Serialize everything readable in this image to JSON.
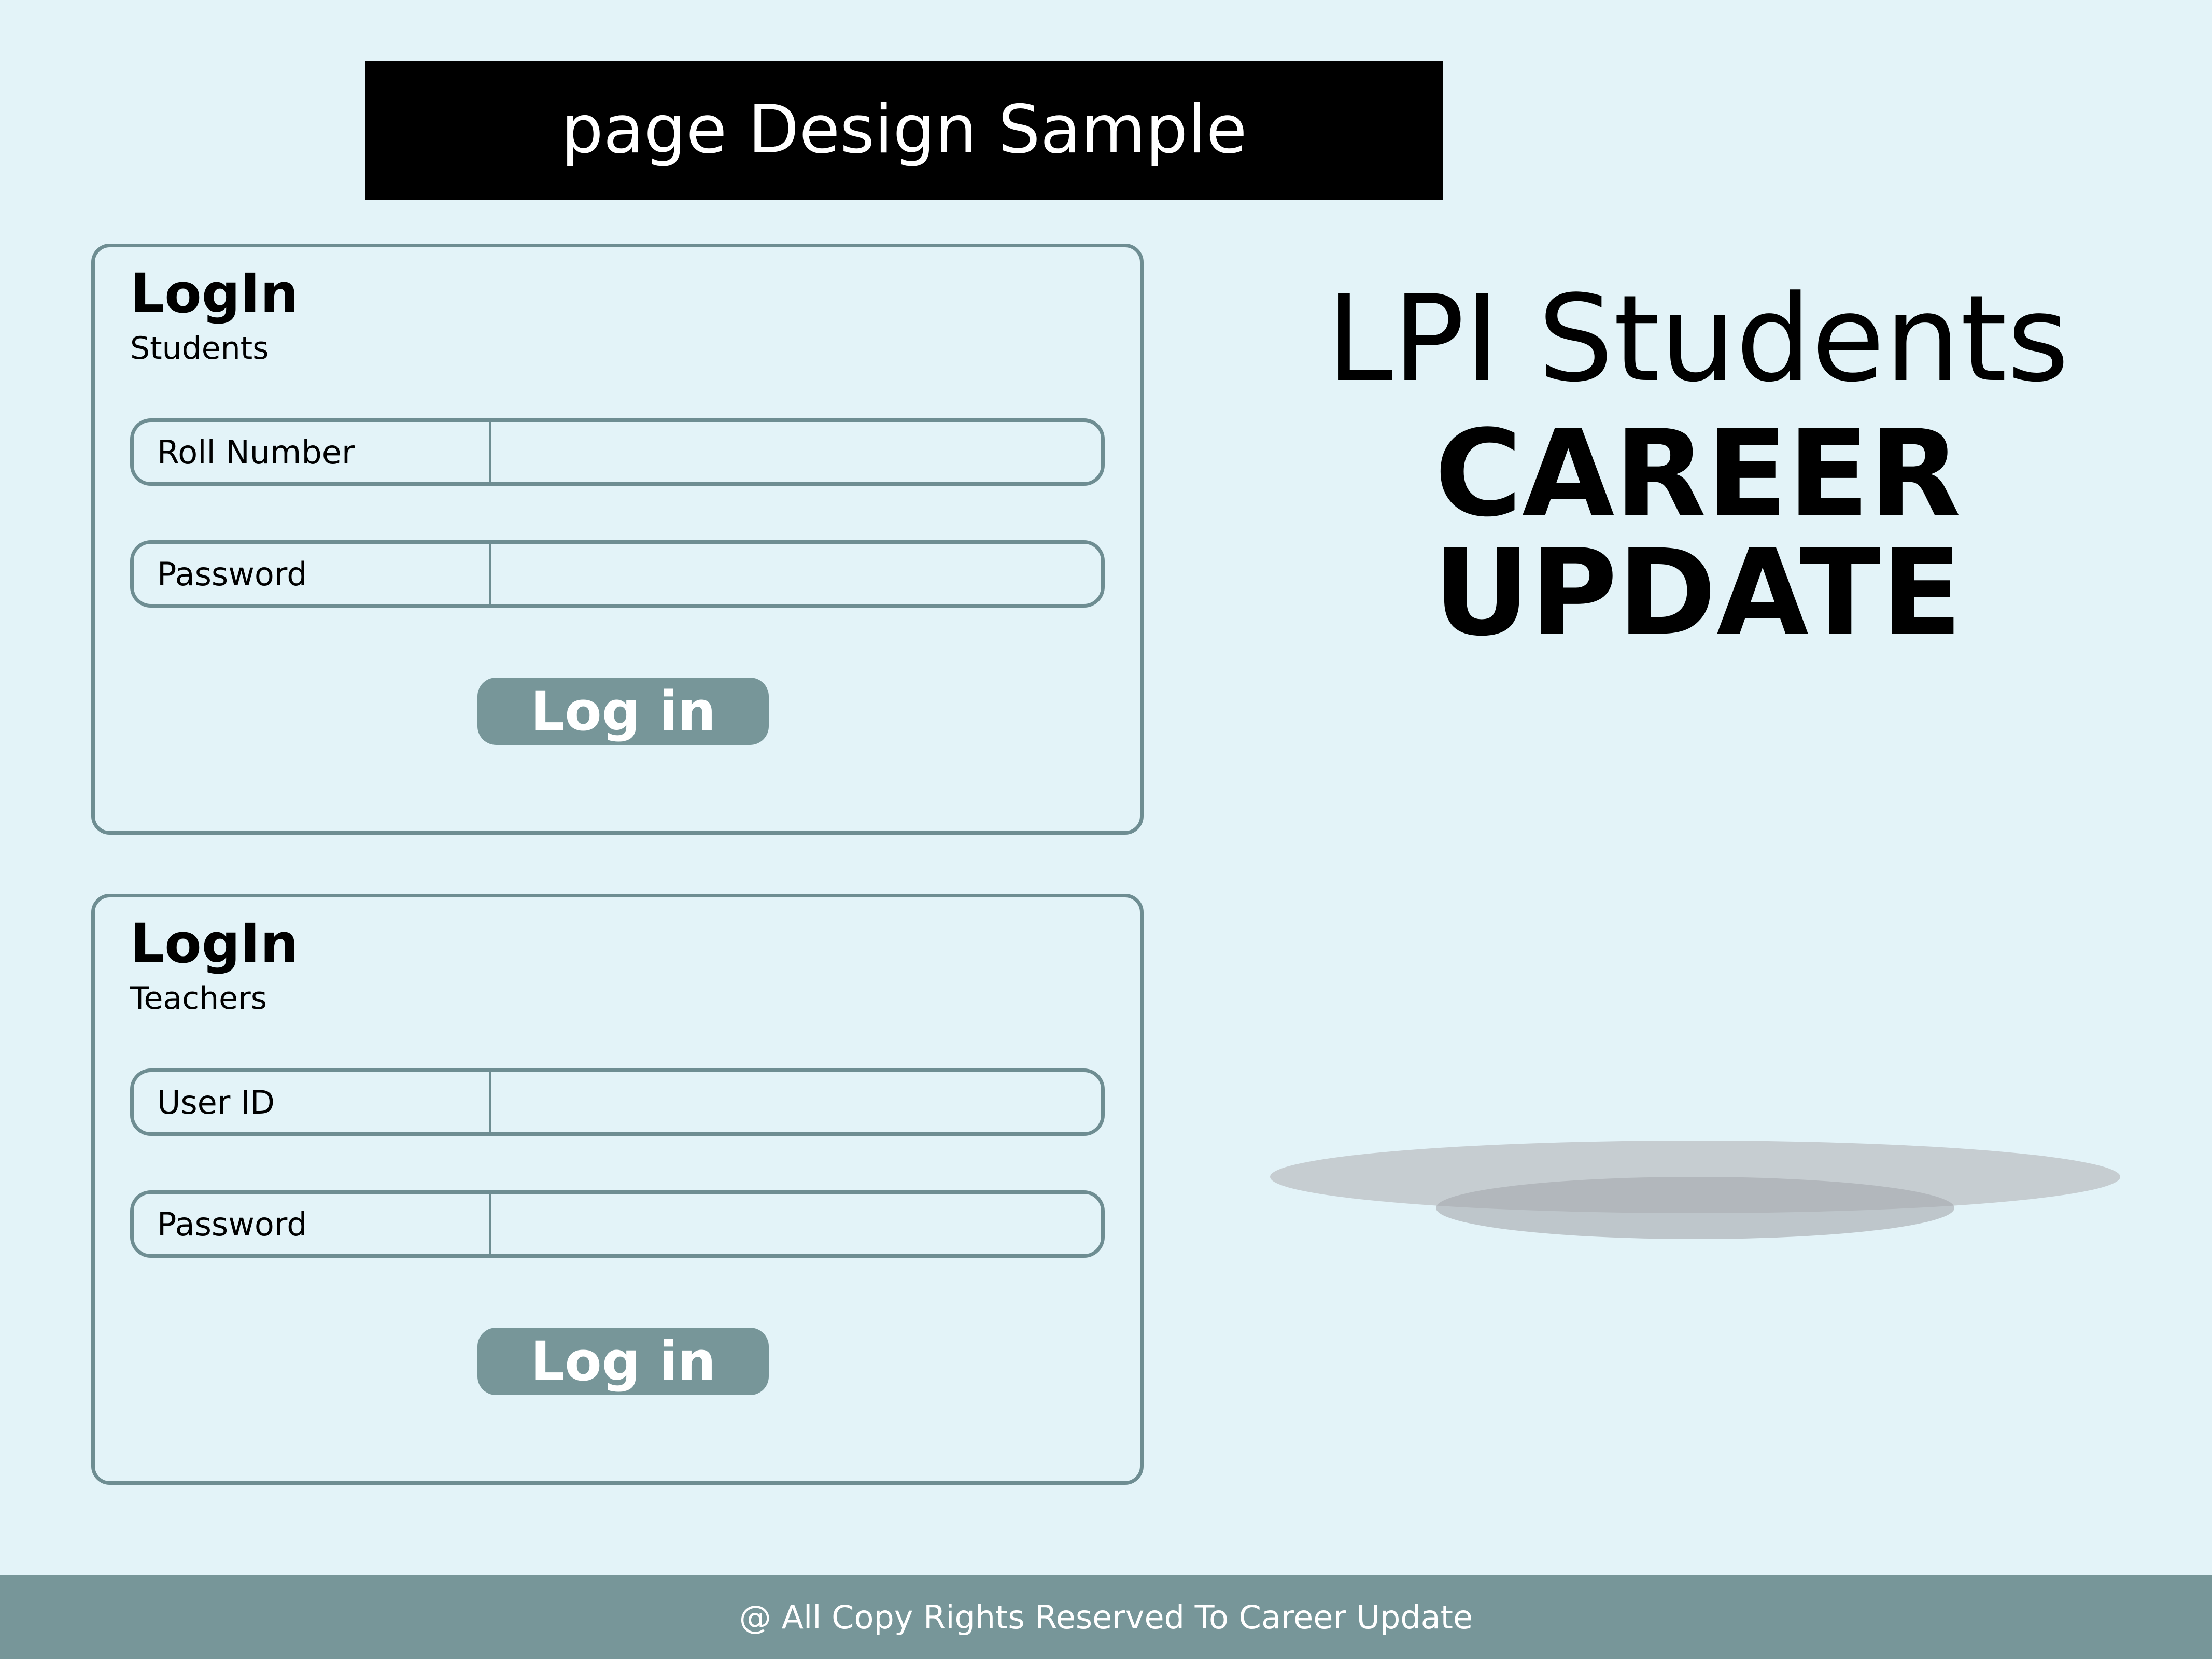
{
  "banner": {
    "title": "page Design Sample"
  },
  "student_login": {
    "title": "LogIn",
    "subtitle": "Students",
    "field1_label": "Roll Number",
    "field2_label": "Password",
    "button_label": "Log in"
  },
  "teacher_login": {
    "title": "LogIn",
    "subtitle": "Teachers",
    "field1_label": "User ID",
    "field2_label": "Password",
    "button_label": "Log in"
  },
  "hero": {
    "line1": "LPI Students",
    "line2": "CAREER UPDATE"
  },
  "illustration": {
    "icon": "professionals-group-illustration"
  },
  "footer": {
    "text": "@ All Copy Rights Reserved To Career Update"
  },
  "colors": {
    "background": "#e3f3f8",
    "accent": "#779699",
    "border": "#6e8d92",
    "banner": "#000000"
  }
}
